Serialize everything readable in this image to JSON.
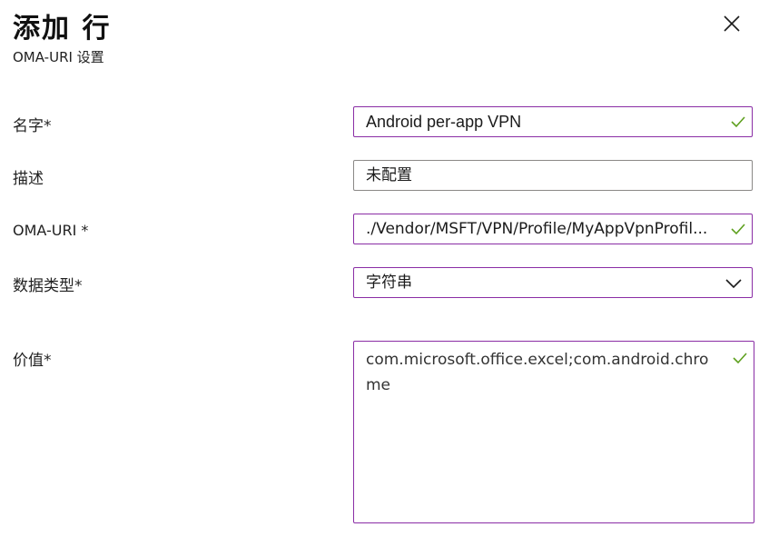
{
  "header": {
    "title": "添加 行",
    "subtitle": "OMA-URI 设置",
    "close_icon": "close-icon"
  },
  "form": {
    "name": {
      "label": "名字*",
      "value": "Android per-app VPN",
      "status_icon": "checkmark-icon"
    },
    "description": {
      "label": "描述",
      "value": "未配置"
    },
    "oma_uri": {
      "label": "OMA-URI *",
      "value": "./Vendor/MSFT/VPN/Profile/MyAppVpnProfil...",
      "status_icon": "checkmark-icon"
    },
    "data_type": {
      "label": "数据类型*",
      "selected": "字符串",
      "dropdown_icon": "chevron-down-icon"
    },
    "value": {
      "label": "价值*",
      "value": "com.microsoft.office.excel;com.android.chrome",
      "status_icon": "checkmark-icon"
    }
  },
  "colors": {
    "valid_border": "#8a2da5",
    "default_border": "#8a8886",
    "check_green": "#5ea01f"
  }
}
